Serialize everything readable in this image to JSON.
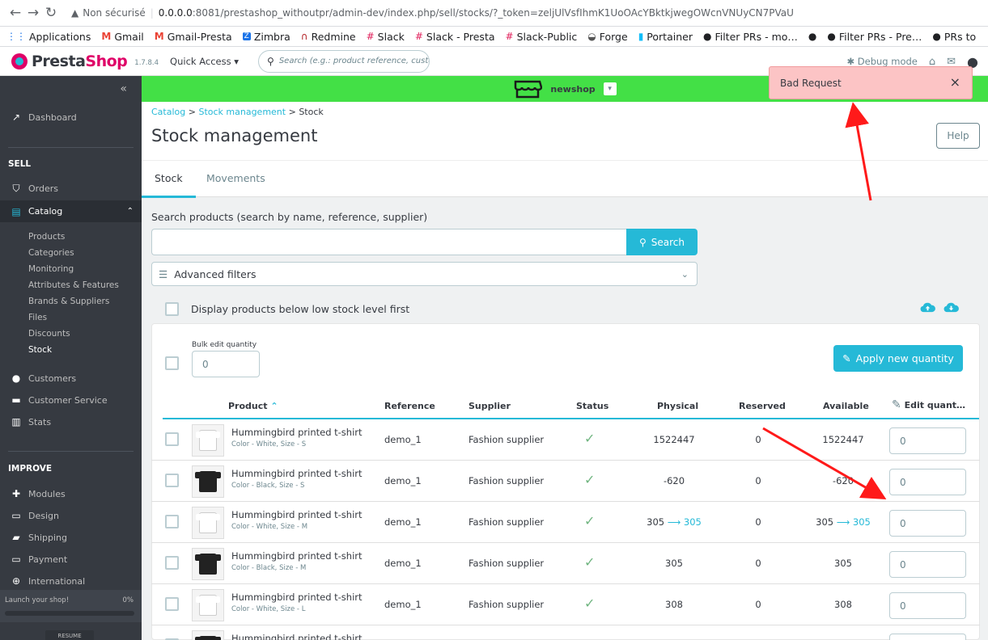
{
  "browser": {
    "url_warning": "Non sécurisé",
    "url_host": "0.0.0.0",
    "url_path": ":8081/prestashop_withoutpr/admin-dev/index.php/sell/stocks/?_token=zeljUlVsfIhmK1UoOAcYBktkjwegOWcnVNUyCN7PVaU",
    "bookmarks": [
      "Applications",
      "Gmail",
      "Gmail-Presta",
      "Zimbra",
      "Redmine",
      "Slack",
      "Slack - Presta",
      "Slack-Public",
      "Forge",
      "Portainer",
      "Filter PRs - mo…",
      "",
      "Filter PRs - Pre…",
      "PRs to"
    ]
  },
  "header": {
    "logo_prefix": "Presta",
    "logo_suffix": "Shop",
    "version": "1.7.8.4",
    "quick_access": "Quick Access",
    "search_placeholder": "Search (e.g.: product reference, custon",
    "debug_mode": "Debug mode"
  },
  "sidebar": {
    "dashboard": "Dashboard",
    "sell_title": "SELL",
    "orders": "Orders",
    "catalog": "Catalog",
    "catalog_sub": [
      "Products",
      "Categories",
      "Monitoring",
      "Attributes & Features",
      "Brands & Suppliers",
      "Files",
      "Discounts",
      "Stock"
    ],
    "customers": "Customers",
    "customer_service": "Customer Service",
    "stats": "Stats",
    "improve_title": "IMPROVE",
    "modules": "Modules",
    "design": "Design",
    "shipping": "Shipping",
    "payment": "Payment",
    "international": "International",
    "launch_text": "Launch your shop!",
    "launch_progress": "0%",
    "resume": "RESUME"
  },
  "shopbar": {
    "name": "newshop"
  },
  "page": {
    "breadcrumb": [
      "Catalog",
      "Stock management",
      "Stock"
    ],
    "title": "Stock management",
    "help": "Help",
    "tabs": [
      "Stock",
      "Movements"
    ],
    "search_label": "Search products (search by name, reference, supplier)",
    "search_button": "Search",
    "advanced_filters": "Advanced filters",
    "low_stock_label": "Display products below low stock level first",
    "bulk_label": "Bulk edit quantity",
    "bulk_value": "0",
    "apply_button": "Apply new quantity"
  },
  "table": {
    "columns": [
      "Product",
      "Reference",
      "Supplier",
      "Status",
      "Physical",
      "Reserved",
      "Available",
      "Edit quant…"
    ],
    "rows": [
      {
        "name": "Hummingbird printed t-shirt",
        "attr": "Color - White, Size - S",
        "color": "white",
        "ref": "demo_1",
        "supplier": "Fashion supplier",
        "physical": "1522447",
        "reserved": "0",
        "available": "1522447",
        "edit": "0"
      },
      {
        "name": "Hummingbird printed t-shirt",
        "attr": "Color - Black, Size - S",
        "color": "black",
        "ref": "demo_1",
        "supplier": "Fashion supplier",
        "physical": "-620",
        "reserved": "0",
        "available": "-620",
        "edit": "0"
      },
      {
        "name": "Hummingbird printed t-shirt",
        "attr": "Color - White, Size - M",
        "color": "white",
        "ref": "demo_1",
        "supplier": "Fashion supplier",
        "physical": "305",
        "physical_new": "305",
        "reserved": "0",
        "available": "305",
        "available_new": "305",
        "edit": "0"
      },
      {
        "name": "Hummingbird printed t-shirt",
        "attr": "Color - Black, Size - M",
        "color": "black",
        "ref": "demo_1",
        "supplier": "Fashion supplier",
        "physical": "305",
        "reserved": "0",
        "available": "305",
        "edit": "0"
      },
      {
        "name": "Hummingbird printed t-shirt",
        "attr": "Color - White, Size - L",
        "color": "white",
        "ref": "demo_1",
        "supplier": "Fashion supplier",
        "physical": "308",
        "reserved": "0",
        "available": "308",
        "edit": "0"
      },
      {
        "name": "Hummingbird printed t-shirt",
        "attr": "",
        "color": "black",
        "ref": "",
        "supplier": "",
        "physical": "",
        "reserved": "",
        "available": "",
        "edit": ""
      }
    ]
  },
  "toast": {
    "message": "Bad Request",
    "close": "×"
  },
  "colors": {
    "accent": "#25b9d7",
    "shopbar": "#43e046",
    "toast_bg": "#fcc4c5",
    "annotation": "#ff0000"
  }
}
